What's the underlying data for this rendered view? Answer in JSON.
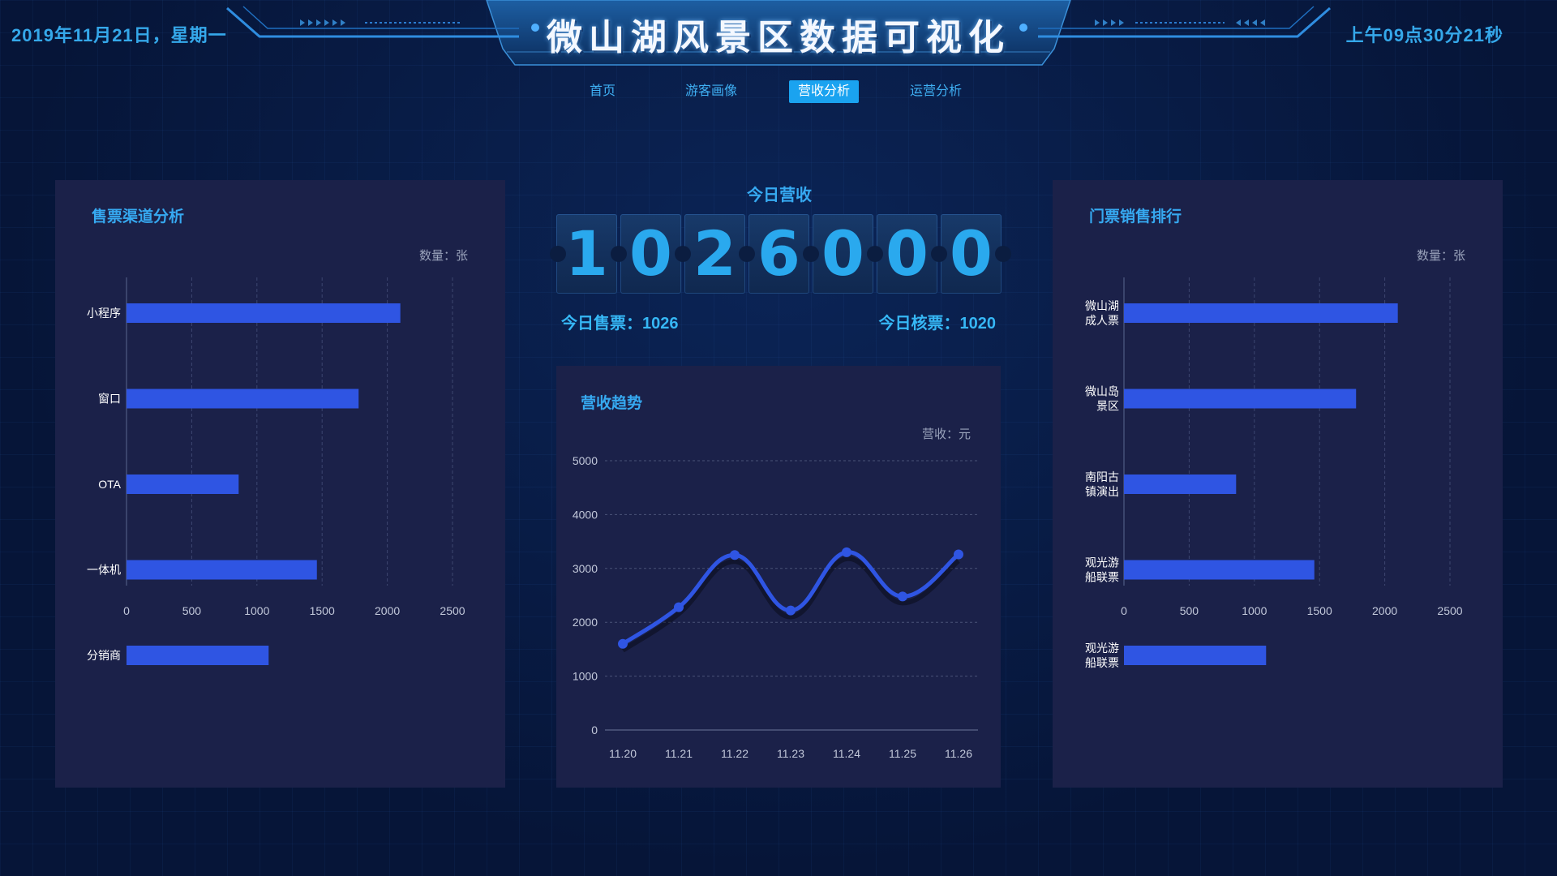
{
  "header": {
    "date": "2019年11月21日，星期一",
    "title": "微山湖风景区数据可视化",
    "time": "上午09点30分21秒"
  },
  "tabs": [
    {
      "label": "首页",
      "active": false
    },
    {
      "label": "游客画像",
      "active": false
    },
    {
      "label": "营收分析",
      "active": true
    },
    {
      "label": "运营分析",
      "active": false
    }
  ],
  "channel_panel": {
    "title": "售票渠道分析",
    "unit": "数量：张"
  },
  "revenue": {
    "label": "今日营收",
    "digits": [
      "1",
      "0",
      "2",
      "6",
      "0",
      "0",
      "0"
    ],
    "sold": "今日售票：1026",
    "checked": "今日核票：1020"
  },
  "trend_panel": {
    "title": "营收趋势",
    "unit": "营收：元"
  },
  "ranking_panel": {
    "title": "门票销售排行",
    "unit": "数量：张"
  },
  "colors": {
    "accent": "#36a9f1",
    "bar": "#2f55e3",
    "panel_bg": "#1b2149",
    "page_bg": "#061538"
  },
  "chart_data": [
    {
      "id": "channel",
      "type": "bar",
      "orientation": "horizontal",
      "categories": [
        "小程序",
        "窗口",
        "OTA",
        "一体机",
        "分销商"
      ],
      "values": [
        2100,
        1780,
        860,
        1460,
        1090
      ],
      "xlim": [
        0,
        2500
      ],
      "xticks": [
        0,
        500,
        1000,
        1500,
        2000,
        2500
      ],
      "unit_label": "数量：张",
      "grid": true
    },
    {
      "id": "trend",
      "type": "line",
      "smooth": true,
      "x": [
        "11.20",
        "11.21",
        "11.22",
        "11.23",
        "11.24",
        "11.25",
        "11.26"
      ],
      "values": [
        1600,
        2280,
        3250,
        2220,
        3300,
        2480,
        3260
      ],
      "ylim": [
        0,
        5000
      ],
      "yticks": [
        0,
        1000,
        2000,
        3000,
        4000,
        5000
      ],
      "unit_label": "营收：元",
      "grid": true
    },
    {
      "id": "ranking",
      "type": "bar",
      "orientation": "horizontal",
      "categories": [
        [
          "微山湖",
          "成人票"
        ],
        [
          "微山岛",
          "景区"
        ],
        [
          "南阳古",
          "镇演出"
        ],
        [
          "观光游",
          "船联票"
        ],
        [
          "观光游",
          "船联票"
        ]
      ],
      "values": [
        2100,
        1780,
        860,
        1460,
        1090
      ],
      "xlim": [
        0,
        2500
      ],
      "xticks": [
        0,
        500,
        1000,
        1500,
        2000,
        2500
      ],
      "unit_label": "数量：张",
      "grid": true
    }
  ]
}
